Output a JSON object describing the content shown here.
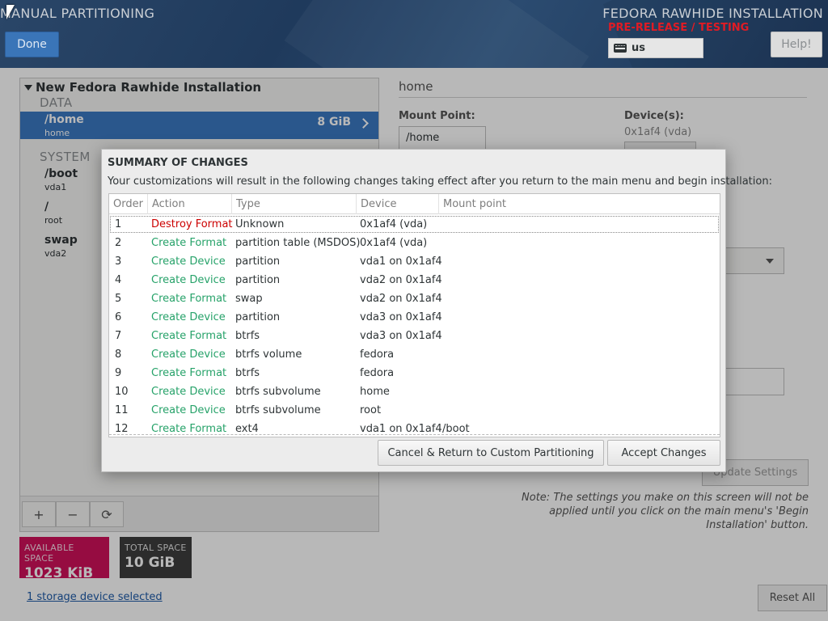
{
  "header": {
    "title": "MANUAL PARTITIONING",
    "done_label": "Done",
    "product": "FEDORA RAWHIDE INSTALLATION",
    "prerelease": "PRE-RELEASE / TESTING",
    "keyboard_layout": "us",
    "help_label": "Help!"
  },
  "left_panel": {
    "install_title": "New Fedora Rawhide Installation",
    "data_section": "DATA",
    "system_section": "SYSTEM",
    "mounts": [
      {
        "name": "/home",
        "device": "home",
        "size": "8 GiB"
      },
      {
        "name": "/boot",
        "device": "vda1"
      },
      {
        "name": "/",
        "device": "root"
      },
      {
        "name": "swap",
        "device": "vda2"
      }
    ],
    "toolbar": {
      "add": "+",
      "remove": "−",
      "refresh": "⟳"
    }
  },
  "space": {
    "available_label": "AVAILABLE SPACE",
    "available_value": "1023 KiB",
    "total_label": "TOTAL SPACE",
    "total_value": "10 GiB"
  },
  "storage_link": "1 storage device selected",
  "right_panel": {
    "title": "home",
    "mount_point_label": "Mount Point:",
    "mount_point_value": "/home",
    "devices_label": "Device(s):",
    "devices_value": "0x1af4 (vda)",
    "update_label": "Update Settings",
    "note": "Note:  The settings you make on this screen will not be applied until you click on the main menu's 'Begin Installation' button.",
    "reset_label": "Reset All"
  },
  "dialog": {
    "title": "SUMMARY OF CHANGES",
    "description": "Your customizations will result in the following changes taking effect after you return to the main menu and begin installation:",
    "columns": [
      "Order",
      "Action",
      "Type",
      "Device",
      "Mount point"
    ],
    "rows": [
      {
        "order": "1",
        "action": "Destroy Format",
        "type": "Unknown",
        "device": "0x1af4 (vda)",
        "mount": ""
      },
      {
        "order": "2",
        "action": "Create Format",
        "type": "partition table (MSDOS)",
        "device": "0x1af4 (vda)",
        "mount": ""
      },
      {
        "order": "3",
        "action": "Create Device",
        "type": "partition",
        "device": "vda1 on 0x1af4",
        "mount": ""
      },
      {
        "order": "4",
        "action": "Create Device",
        "type": "partition",
        "device": "vda2 on 0x1af4",
        "mount": ""
      },
      {
        "order": "5",
        "action": "Create Format",
        "type": "swap",
        "device": "vda2 on 0x1af4",
        "mount": ""
      },
      {
        "order": "6",
        "action": "Create Device",
        "type": "partition",
        "device": "vda3 on 0x1af4",
        "mount": ""
      },
      {
        "order": "7",
        "action": "Create Format",
        "type": "btrfs",
        "device": "vda3 on 0x1af4",
        "mount": ""
      },
      {
        "order": "8",
        "action": "Create Device",
        "type": "btrfs volume",
        "device": "fedora",
        "mount": ""
      },
      {
        "order": "9",
        "action": "Create Format",
        "type": "btrfs",
        "device": "fedora",
        "mount": ""
      },
      {
        "order": "10",
        "action": "Create Device",
        "type": "btrfs subvolume",
        "device": "home",
        "mount": ""
      },
      {
        "order": "11",
        "action": "Create Device",
        "type": "btrfs subvolume",
        "device": "root",
        "mount": ""
      },
      {
        "order": "12",
        "action": "Create Format",
        "type": "ext4",
        "device": "vda1 on 0x1af4",
        "mount": "/boot"
      }
    ],
    "cancel_label": "Cancel & Return to Custom Partitioning",
    "accept_label": "Accept Changes"
  },
  "colors": {
    "destroy": "#cc0000",
    "create": "#26a269",
    "selected_row": "#3b79c2",
    "available_space": "#d0115b",
    "prerelease": "#e01b24"
  }
}
